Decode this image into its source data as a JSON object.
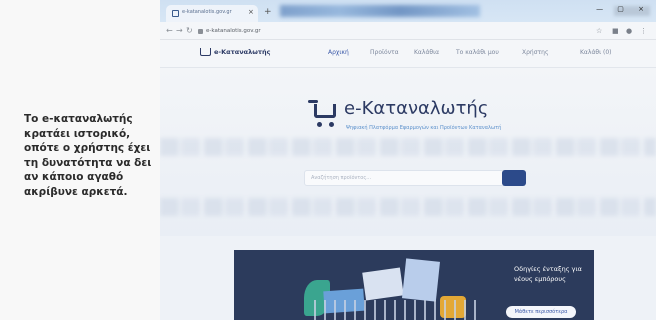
{
  "caption": {
    "text": "Το e-καταναλωτής κρατάει ιστορικό, οπότε ο χρήστης έχει τη δυνατότητα να δει αν κάποιο αγαθό ακρίβυνε αρκετά."
  },
  "browser": {
    "tab_title": "e-katanalotis.gov.gr",
    "tab_close": "×",
    "new_tab": "+",
    "url": "e-katanalotis.gov.gr",
    "window_controls": "— ▢ ×"
  },
  "site": {
    "logo_small": "e-Καταναλωτής",
    "nav": {
      "home": "Αρχική",
      "products": "Προϊόντα",
      "stores": "Καλάθια",
      "basket": "Το καλάθι μου",
      "user": "Χρήστης",
      "cart": "Καλάθι (0)"
    },
    "brand": "e-Καταναλωτής",
    "tagline": "Ψηφιακή Πλατφόρμα Εφαρμογών και Προϊόντων Καταναλωτή",
    "search_placeholder": "Αναζήτηση προϊόντος...",
    "promo": {
      "title": "Οδηγίες ένταξης για νέους εμπόρους",
      "button": "Μάθετε περισσότερα"
    }
  },
  "colors": {
    "brand": "#2c3a63",
    "accent": "#3a58a8",
    "promo_bg": "#2c3b5c"
  }
}
